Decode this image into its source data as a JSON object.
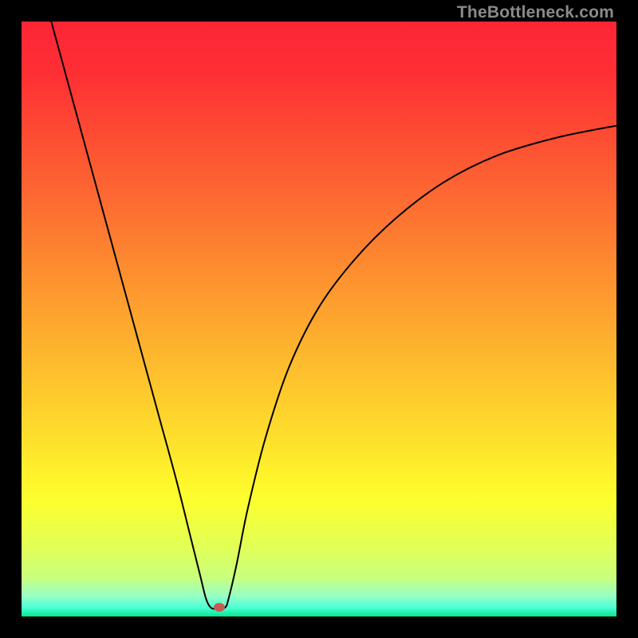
{
  "watermark": "TheBottleneck.com",
  "colors": {
    "frame": "#000000",
    "watermark": "#8a8a8a",
    "gradient_stops": [
      {
        "pos": 0.0,
        "color": "#fd2536"
      },
      {
        "pos": 0.09,
        "color": "#fe3034"
      },
      {
        "pos": 0.18,
        "color": "#fd4933"
      },
      {
        "pos": 0.27,
        "color": "#fd6232"
      },
      {
        "pos": 0.36,
        "color": "#fd7c31"
      },
      {
        "pos": 0.45,
        "color": "#fe972f"
      },
      {
        "pos": 0.54,
        "color": "#fdb12e"
      },
      {
        "pos": 0.63,
        "color": "#fecb2d"
      },
      {
        "pos": 0.72,
        "color": "#fde52c"
      },
      {
        "pos": 0.77,
        "color": "#fff52b"
      },
      {
        "pos": 0.81,
        "color": "#fbff2f"
      },
      {
        "pos": 0.85,
        "color": "#edff45"
      },
      {
        "pos": 0.89,
        "color": "#dfff5b"
      },
      {
        "pos": 0.935,
        "color": "#c8ff7e"
      },
      {
        "pos": 0.965,
        "color": "#98ffc4"
      },
      {
        "pos": 0.985,
        "color": "#4dffd6"
      },
      {
        "pos": 1.0,
        "color": "#00e98e"
      }
    ],
    "curve": "#000000",
    "marker": "#c65b53"
  },
  "chart_data": {
    "type": "line",
    "title": "",
    "xlabel": "",
    "ylabel": "",
    "xlim": [
      0,
      100
    ],
    "ylim": [
      0,
      100
    ],
    "series": [
      {
        "name": "bottleneck-curve",
        "x": [
          5,
          8,
          11,
          14,
          17,
          20,
          23,
          26,
          28.5,
          30,
          31,
          31.8,
          32.8,
          34.2,
          34.8,
          36.2,
          38,
          41,
          45,
          50,
          56,
          63,
          71,
          80,
          90,
          100
        ],
        "y": [
          100,
          89,
          78,
          67,
          56,
          45,
          34,
          23,
          13,
          7,
          3,
          1.5,
          1.3,
          1.5,
          3,
          9,
          18,
          30,
          42,
          52,
          60,
          67,
          73,
          77.5,
          80.5,
          82.5
        ]
      }
    ],
    "markers": [
      {
        "name": "optimum-point",
        "x": 33.3,
        "y": 1.5
      }
    ],
    "grid": false,
    "legend": false
  }
}
